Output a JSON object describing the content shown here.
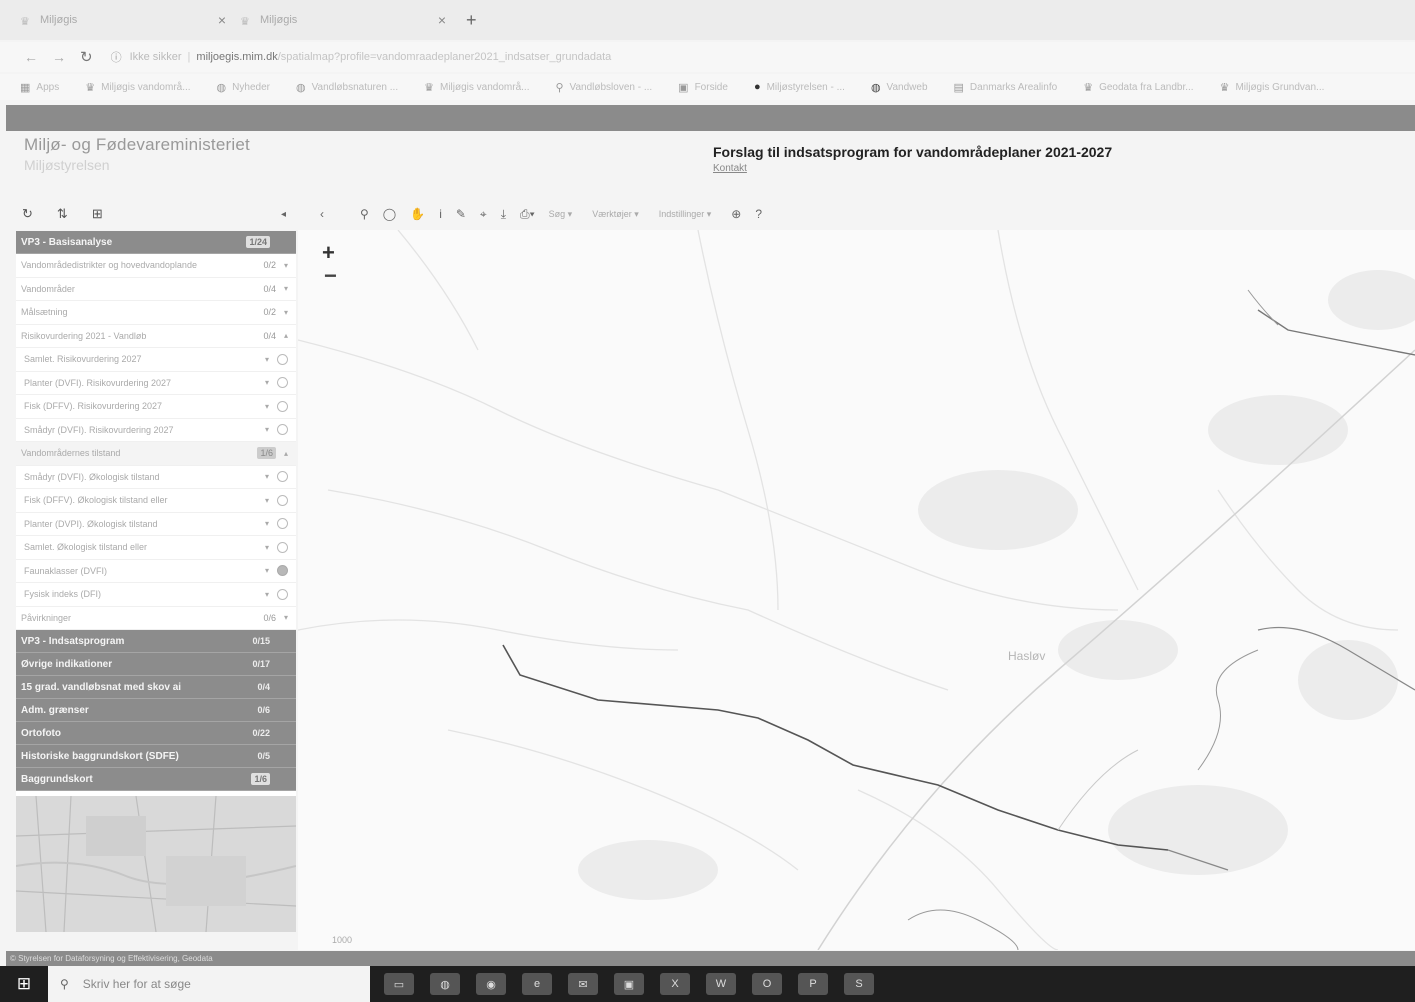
{
  "browser": {
    "tabs": [
      {
        "title": "Miljøgis"
      },
      {
        "title": "Miljøgis"
      }
    ],
    "new_tab_icon": "+",
    "address": {
      "secure_label": "Ikke sikker",
      "host": "miljoegis.mim.dk",
      "path": "/spatialmap?profile=vandomraadeplaner2021_indsatser_grundadata"
    },
    "bookmarks": [
      {
        "label": "Apps",
        "icon": "grid-icon"
      },
      {
        "label": "Miljøgis vandområ...",
        "icon": "crown-icon"
      },
      {
        "label": "Nyheder",
        "icon": "globe-icon"
      },
      {
        "label": "Vandløbsnaturen ...",
        "icon": "globe-icon"
      },
      {
        "label": "Miljøgis vandområ...",
        "icon": "crown-icon"
      },
      {
        "label": "Vandløbsloven - ...",
        "icon": "link-icon"
      },
      {
        "label": "Forside",
        "icon": "page-icon"
      },
      {
        "label": "Miljøstyrelsen - ...",
        "icon": "circle-icon"
      },
      {
        "label": "Vandweb",
        "icon": "globe-icon"
      },
      {
        "label": "Danmarks Arealinfo",
        "icon": "map-icon"
      },
      {
        "label": "Geodata fra Landbr...",
        "icon": "crown-icon"
      },
      {
        "label": "Miljøgis Grundvan...",
        "icon": "crown-icon"
      }
    ]
  },
  "site": {
    "ministry": "Miljø- og Fødevareministeriet",
    "agency": "Miljøstyrelsen",
    "title": "Forslag til indsatsprogram for vandområdeplaner 2021-2027",
    "subtitle": "Kontakt"
  },
  "sidebar": {
    "groups": [
      {
        "label": "VP3 - Basisanalyse",
        "count": "1/24",
        "boxed": true
      },
      {
        "label": "VP3 - Indsatsprogram",
        "count": "0/15",
        "boxed": false
      },
      {
        "label": "Øvrige indikationer",
        "count": "0/17",
        "boxed": false
      },
      {
        "label": "15 grad. vandløbsnat med skov ai",
        "count": "0/4",
        "boxed": false
      },
      {
        "label": "Adm. grænser",
        "count": "0/6",
        "boxed": false
      },
      {
        "label": "Ortofoto",
        "count": "0/22",
        "boxed": false
      },
      {
        "label": "Historiske baggrundskort (SDFE)",
        "count": "0/5",
        "boxed": false
      },
      {
        "label": "Baggrundskort",
        "count": "1/6",
        "boxed": true
      }
    ],
    "rows": [
      {
        "label": "Vandområdedistrikter og hovedvandoplande",
        "count": "0/2"
      },
      {
        "label": "Vandområder",
        "count": "0/4"
      },
      {
        "label": "Målsætning",
        "count": "0/2"
      },
      {
        "label": "Risikovurdering 2021 - Vandløb",
        "count": "0/4"
      },
      {
        "label": "Samlet. Risikovurdering 2027"
      },
      {
        "label": "Planter (DVFI). Risikovurdering 2027"
      },
      {
        "label": "Fisk (DFFV). Risikovurdering 2027"
      },
      {
        "label": "Smådyr (DVFI). Risikovurdering 2027"
      },
      {
        "label": "Vandområdernes tilstand",
        "count": "1/6"
      },
      {
        "label": "Smådyr (DVFI). Økologisk tilstand"
      },
      {
        "label": "Fisk (DFFV). Økologisk tilstand eller"
      },
      {
        "label": "Planter (DVPI). Økologisk tilstand"
      },
      {
        "label": "Samlet. Økologisk tilstand eller"
      },
      {
        "label": "Faunaklasser (DVFI)"
      },
      {
        "label": "Fysisk indeks (DFI)"
      },
      {
        "label": "Påvirkninger",
        "count": "0/6"
      }
    ]
  },
  "toolbar": {
    "dropdowns": [
      "Søg",
      "Værktøjer",
      "Indstillinger"
    ]
  },
  "map": {
    "place_label": "Hasløv",
    "scale": "1000"
  },
  "footer": {
    "credit": "© Styrelsen for Dataforsyning og Effektivisering, Geodata"
  },
  "taskbar": {
    "search_placeholder": "Skriv her for at søge"
  }
}
